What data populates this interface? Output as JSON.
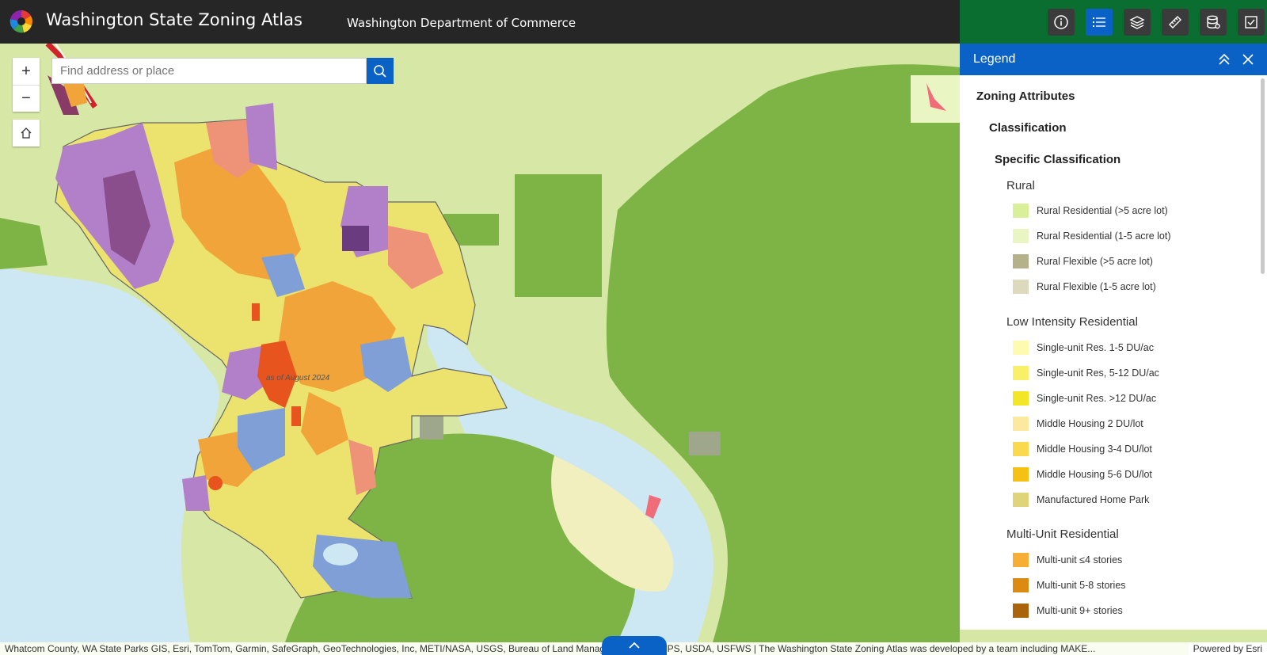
{
  "header": {
    "title": "Washington State Zoning Atlas",
    "department": "Washington Department of Commerce",
    "tools": [
      {
        "icon": "info-icon"
      },
      {
        "icon": "legend-list-icon",
        "active": true
      },
      {
        "icon": "layers-icon"
      },
      {
        "icon": "measure-icon"
      },
      {
        "icon": "database-icon"
      },
      {
        "icon": "checklist-icon"
      }
    ]
  },
  "search": {
    "placeholder": "Find address or place"
  },
  "map": {
    "date_label": "as of August 2024"
  },
  "legend": {
    "title": "Legend",
    "l1": "Zoning Attributes",
    "l2": "Classification",
    "l3": "Specific Classification",
    "groups": [
      {
        "name": "Rural",
        "items": [
          {
            "label": "Rural Residential (>5 acre lot)",
            "color": "#d9ef9a"
          },
          {
            "label": "Rural Residential (1-5 acre lot)",
            "color": "#e9f5c2"
          },
          {
            "label": "Rural Flexible (>5 acre lot)",
            "color": "#b5b18a"
          },
          {
            "label": "Rural Flexible (1-5 acre lot)",
            "color": "#ddd9bf"
          }
        ]
      },
      {
        "name": "Low Intensity Residential",
        "items": [
          {
            "label": "Single-unit Res. 1-5 DU/ac",
            "color": "#fefab0"
          },
          {
            "label": "Single-unit Res, 5-12 DU/ac",
            "color": "#f9f06a"
          },
          {
            "label": "Single-unit Res. >12 DU/ac",
            "color": "#f3e629"
          },
          {
            "label": "Middle Housing 2 DU/lot",
            "color": "#fde8a0"
          },
          {
            "label": "Middle Housing 3-4 DU/lot",
            "color": "#fbd94f"
          },
          {
            "label": "Middle Housing 5-6 DU/lot",
            "color": "#f4c114"
          },
          {
            "label": "Manufactured Home Park",
            "color": "#dfd47a"
          }
        ]
      },
      {
        "name": "Multi-Unit Residential",
        "items": [
          {
            "label": "Multi-unit ≤4 stories",
            "color": "#f7ae35"
          },
          {
            "label": "Multi-unit 5-8 stories",
            "color": "#dd8a12"
          },
          {
            "label": "Multi-unit 9+ stories",
            "color": "#a9640c"
          }
        ]
      }
    ]
  },
  "attribution": "Whatcom County, WA State Parks GIS, Esri, TomTom, Garmin, SafeGraph, GeoTechnologies, Inc, METI/NASA, USGS, Bureau of Land Management, EPA, NPS, USDA, USFWS | The Washington State Zoning Atlas was developed by a team including MAKE...",
  "powered_by": "Powered by Esri"
}
